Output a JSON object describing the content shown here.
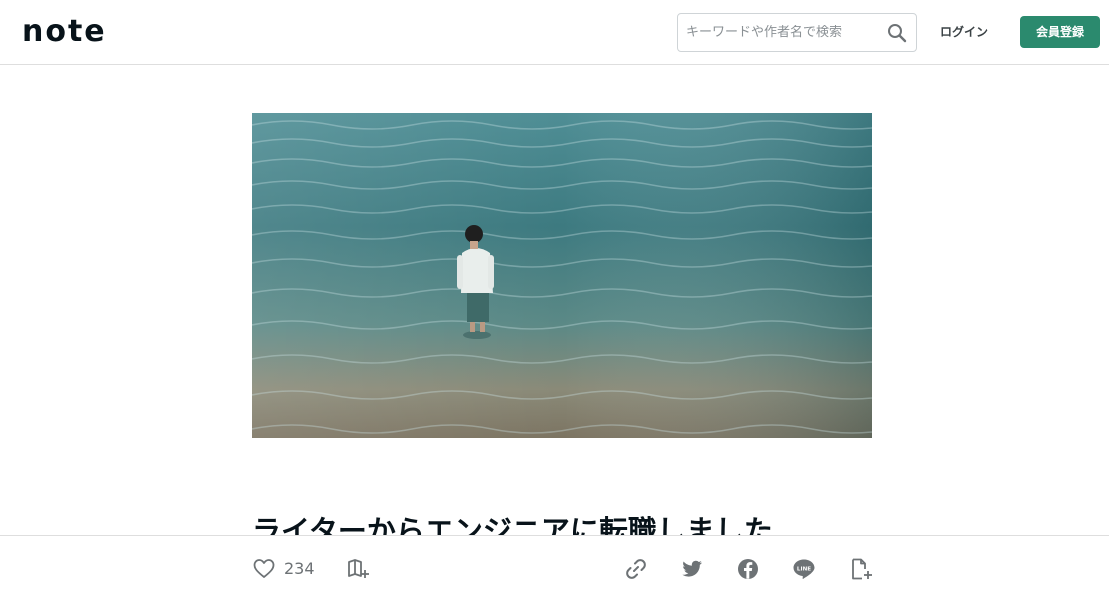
{
  "header": {
    "logo_text": "note",
    "search": {
      "placeholder": "キーワードや作者名で検索",
      "icon": "search-icon"
    },
    "login_label": "ログイン",
    "signup_label": "会員登録",
    "signup_color": "#2b8a6e"
  },
  "article": {
    "title": "ライターからエンジニアに転職しました"
  },
  "actions": {
    "like_icon": "heart-icon",
    "like_count": "234",
    "magazine_icon": "add-to-magazine-icon",
    "share_icons": [
      "link-icon",
      "twitter-icon",
      "facebook-icon",
      "line-icon",
      "embed-icon"
    ],
    "line_badge": "LINE"
  }
}
